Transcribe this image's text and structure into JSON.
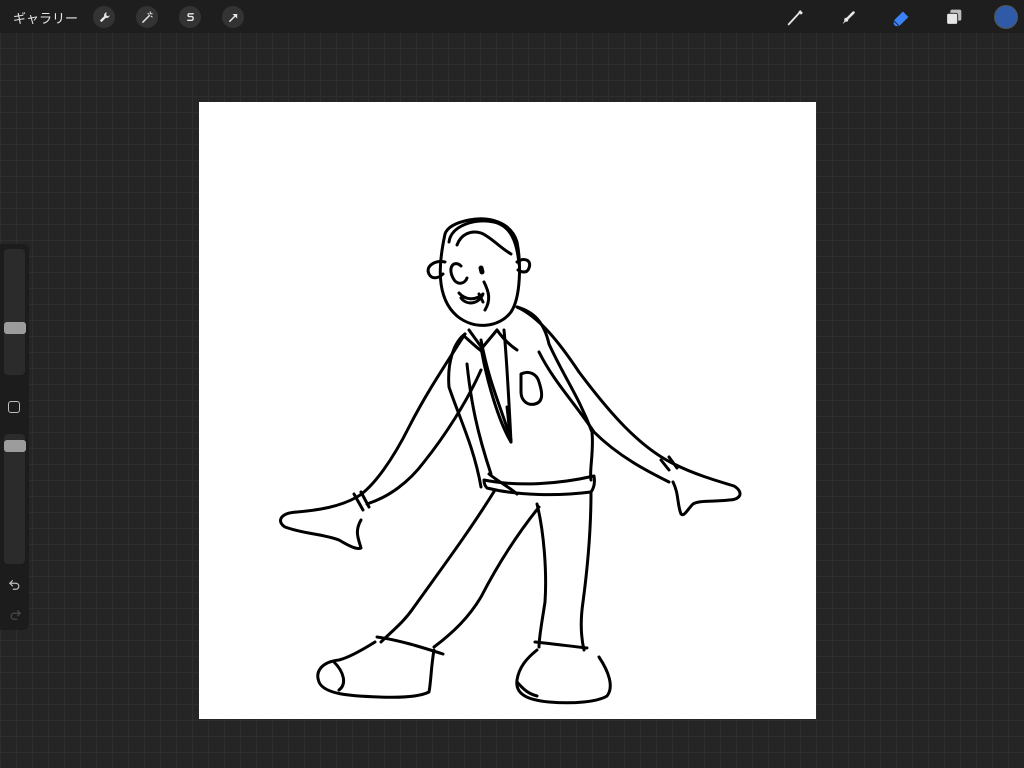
{
  "topbar": {
    "gallery_label": "ギャラリー",
    "left_tools": [
      "wrench-icon",
      "magic-wand-icon",
      "selection-s-icon",
      "transform-arrow-icon"
    ],
    "right_tools": [
      "brush-icon",
      "smudge-icon",
      "eraser-icon",
      "layers-icon"
    ],
    "active_tool": "eraser-icon",
    "current_color": "#2f5aa8",
    "accent_color": "#3b82f6"
  },
  "sidebar": {
    "brush_size": 0.35,
    "opacity": 0.95
  },
  "canvas": {
    "background": "#ffffff",
    "content": "line-drawing-of-man-in-suit"
  }
}
